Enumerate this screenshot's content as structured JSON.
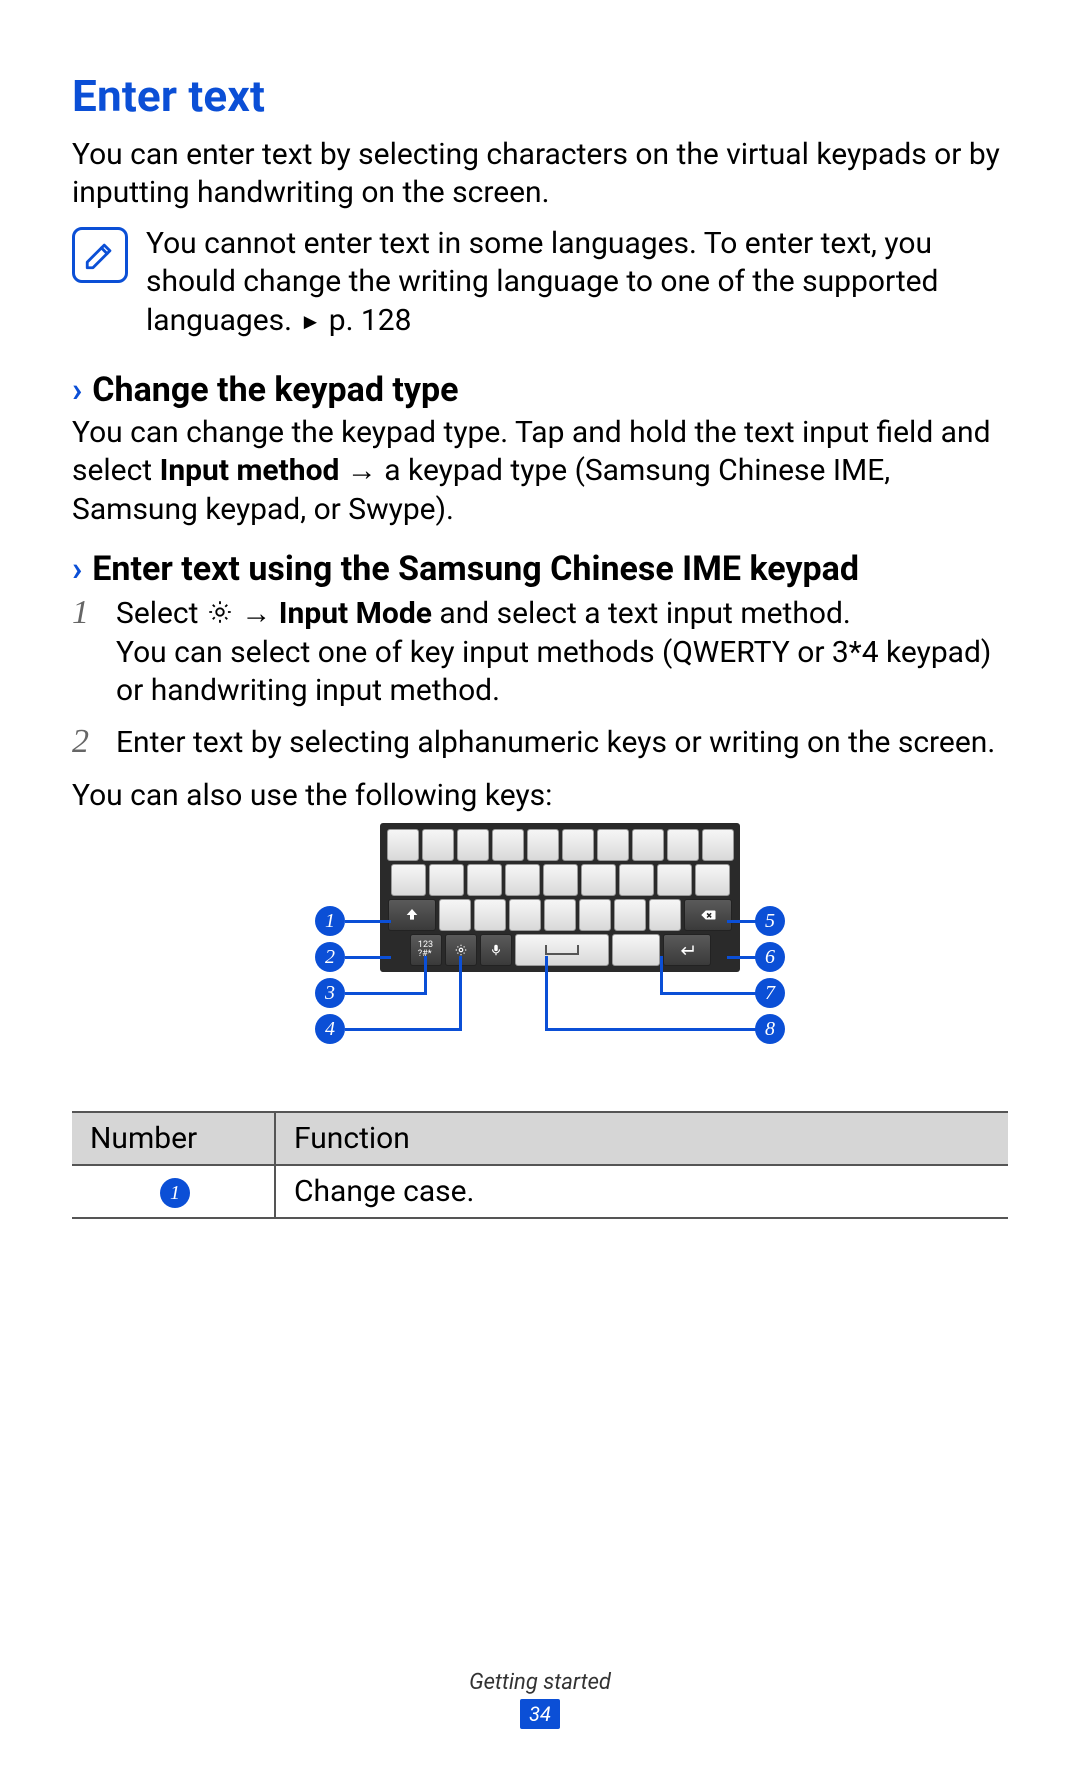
{
  "headings": {
    "main": "Enter text",
    "sub1": "Change the keypad type",
    "sub2": "Enter text using the Samsung Chinese IME keypad"
  },
  "paragraphs": {
    "intro": "You can enter text by selecting characters on the virtual keypads or by inputting handwriting on the screen.",
    "note_pre": "You cannot enter text in some languages. To enter text, you should change the writing language to one of the supported languages. ",
    "note_ref": "p. 128",
    "change_pre": "You can change the keypad type. Tap and hold the text input field and select ",
    "change_bold": "Input method",
    "change_post": " → a keypad type (Samsung Chinese IME, Samsung keypad, or Swype).",
    "following_keys": "You can also use the following keys:"
  },
  "steps": {
    "s1": {
      "num": "1",
      "pre": "Select ",
      "mid": " → ",
      "bold": "Input Mode",
      "post": " and select a text input method.",
      "extra": "You can select one of key input methods (QWERTY or 3*4 keypad) or handwriting input method."
    },
    "s2": {
      "num": "2",
      "text": "Enter text by selecting alphanumeric keys or writing on the screen."
    }
  },
  "callouts": {
    "n1": "1",
    "n2": "2",
    "n3": "3",
    "n4": "4",
    "n5": "5",
    "n6": "6",
    "n7": "7",
    "n8": "8"
  },
  "table": {
    "h1": "Number",
    "h2": "Function",
    "row1_num": "1",
    "row1_fn": "Change case."
  },
  "footer": {
    "section": "Getting started",
    "page": "34"
  }
}
